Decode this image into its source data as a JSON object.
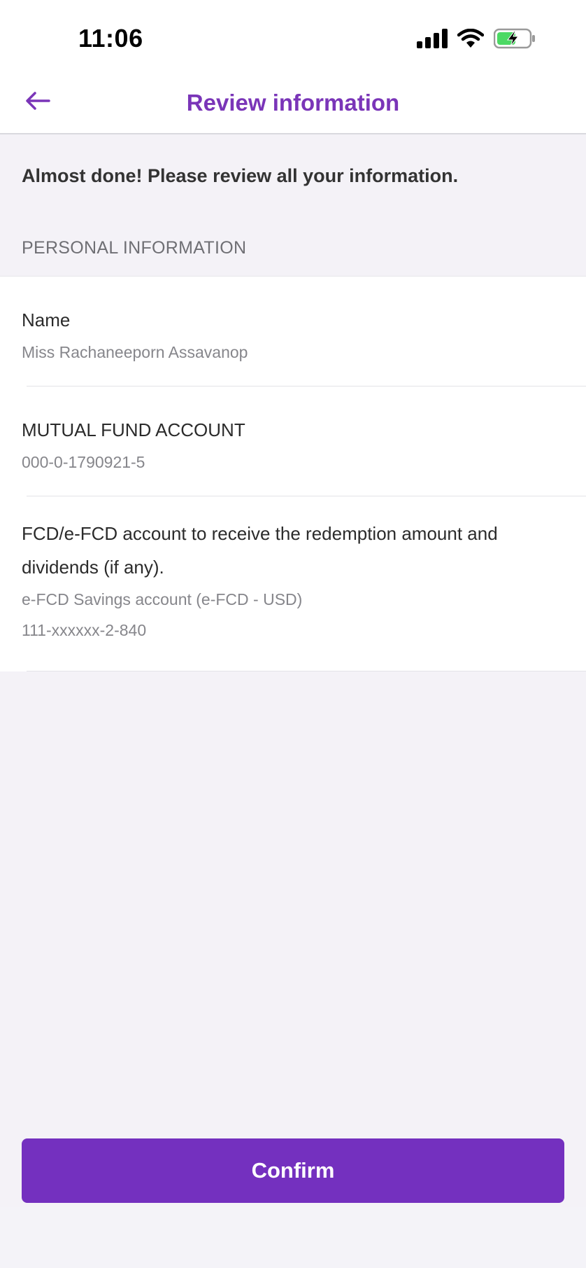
{
  "status_bar": {
    "time": "11:06",
    "icons": [
      "signal-icon",
      "wifi-icon",
      "battery-charging-icon"
    ]
  },
  "nav": {
    "title": "Review information",
    "back_icon": "back-arrow-icon"
  },
  "intro_text": "Almost done! Please review all your information.",
  "section_header": "PERSONAL INFORMATION",
  "rows": [
    {
      "label": "Name",
      "values": [
        "Miss Rachaneeporn Assavanop"
      ]
    },
    {
      "label": "MUTUAL FUND ACCOUNT",
      "values": [
        "000-0-1790921-5"
      ]
    },
    {
      "label": "FCD/e-FCD account to receive the redemption amount and dividends (if any).",
      "values": [
        "e-FCD Savings account (e-FCD - USD)",
        "111-xxxxxx-2-840"
      ]
    }
  ],
  "confirm_label": "Confirm",
  "colors": {
    "accent": "#7430bf",
    "title": "#7a35b8",
    "background": "#f4f2f7"
  }
}
